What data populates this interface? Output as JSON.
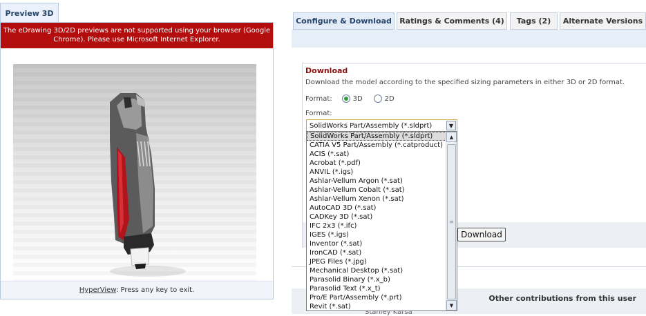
{
  "preview": {
    "tab_label": "Preview 3D",
    "warning": "The eDrawing 3D/2D previews are not supported using your browser (Google Chrome). Please use Microsoft Internet Explorer.",
    "footer_link": "HyperView",
    "footer_text": ": Press any key to exit."
  },
  "tabs": [
    {
      "label": "Configure & Download",
      "active": true
    },
    {
      "label": "Ratings & Comments (4)",
      "active": false
    },
    {
      "label": "Tags (2)",
      "active": false
    },
    {
      "label": "Alternate Versions",
      "active": false
    }
  ],
  "download": {
    "title": "Download",
    "description": "Download the model according to the specified sizing parameters in either 3D or 2D format.",
    "format_label": "Format:",
    "radio_3d": "3D",
    "radio_2d": "2D",
    "format_label2": "Format:",
    "selected_format": "SolidWorks Part/Assembly (*.sldprt)",
    "button_label": "Download"
  },
  "format_options": [
    "SolidWorks Part/Assembly (*.sldprt)",
    "CATIA V5 Part/Assembly (*.catproduct)",
    "ACIS (*.sat)",
    "Acrobat (*.pdf)",
    "ANVIL (*.igs)",
    "Ashlar-Vellum Argon (*.sat)",
    "Ashlar-Vellum Cobalt (*.sat)",
    "Ashlar-Vellum Xenon (*.sat)",
    "AutoCAD 3D (*.sat)",
    "CADKey 3D (*.sat)",
    "IFC 2x3 (*.ifc)",
    "IGES (*.igs)",
    "Inventor (*.sat)",
    "IronCAD (*.sat)",
    "JPEG Files (*.jpg)",
    "Mechanical Desktop (*.sat)",
    "Parasolid Binary (*.x_b)",
    "Parasolid Text (*.x_t)",
    "Pro/E Part/Assembly (*.prt)",
    "Revit (*.sat)"
  ],
  "other": {
    "label": "Other contributions from this user",
    "partial_name": "Stanley Karsa"
  },
  "colors": {
    "warning_bg": "#b40d0d",
    "title_red": "#8b1010",
    "radio_green": "#2e9e3a"
  }
}
